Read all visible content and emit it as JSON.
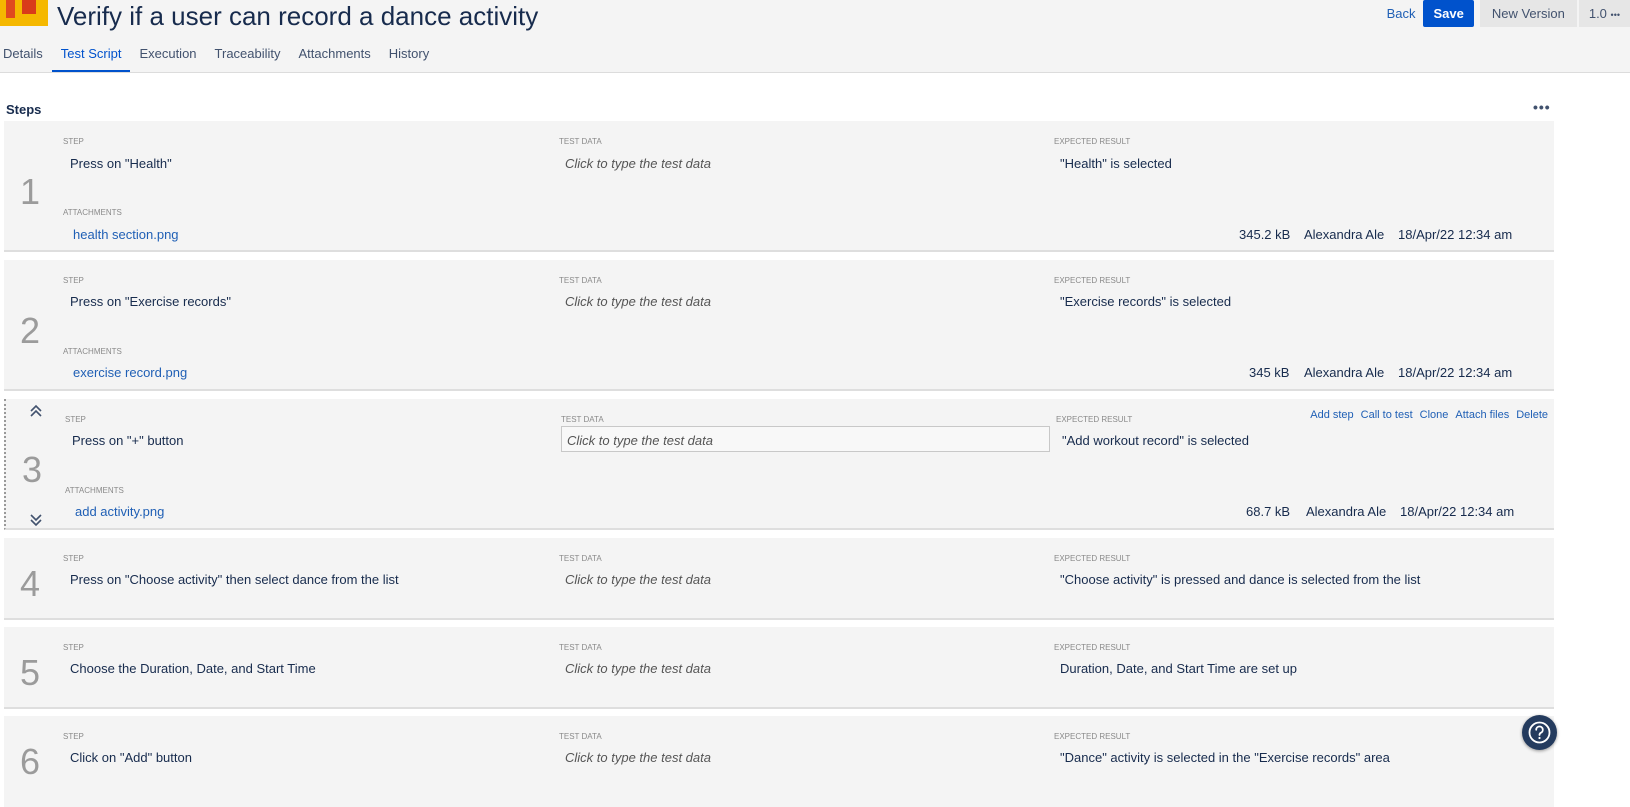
{
  "header": {
    "title": "Verify if a user can record a dance activity",
    "back_label": "Back",
    "save_label": "Save",
    "new_version_label": "New Version",
    "version_label": "1.0",
    "version_more": "•••"
  },
  "tabs": [
    {
      "label": "Details",
      "active": false
    },
    {
      "label": "Test Script",
      "active": true
    },
    {
      "label": "Execution",
      "active": false
    },
    {
      "label": "Traceability",
      "active": false
    },
    {
      "label": "Attachments",
      "active": false
    },
    {
      "label": "History",
      "active": false
    }
  ],
  "steps_section": {
    "title": "Steps",
    "more": "•••",
    "labels": {
      "step": "STEP",
      "test_data": "TEST DATA",
      "expected_result": "EXPECTED RESULT",
      "attachments": "ATTACHMENTS"
    },
    "test_data_placeholder": "Click to type the test data",
    "actions": [
      "Add step",
      "Call to test",
      "Clone",
      "Attach files",
      "Delete"
    ]
  },
  "steps": [
    {
      "number": "1",
      "step": "Press on \"Health\"",
      "expected": "\"Health\" is selected",
      "attachment": {
        "name": "health section.png",
        "size": "345.2 kB",
        "author": "Alexandra Ale",
        "date": "18/Apr/22 12:34 am"
      }
    },
    {
      "number": "2",
      "step": "Press on \"Exercise records\"",
      "expected": "\"Exercise records\" is selected",
      "attachment": {
        "name": "exercise record.png",
        "size": "345 kB",
        "author": "Alexandra Ale",
        "date": "18/Apr/22 12:34 am"
      }
    },
    {
      "number": "3",
      "step": "Press on \"+\" button",
      "expected": "\"Add workout record\" is selected",
      "attachment": {
        "name": "add activity.png",
        "size": "68.7 kB",
        "author": "Alexandra Ale",
        "date": "18/Apr/22 12:34 am"
      }
    },
    {
      "number": "4",
      "step": "Press on \"Choose activity\" then select dance from the list",
      "expected": "\"Choose activity\" is pressed and dance is selected from the list"
    },
    {
      "number": "5",
      "step": "Choose the Duration, Date, and Start Time",
      "expected": "Duration, Date, and Start Time are set up"
    },
    {
      "number": "6",
      "step": "Click on \"Add\" button",
      "expected": "\"Dance\" activity is selected in the \"Exercise records\" area"
    }
  ],
  "icons": {
    "app": "test-case-icon",
    "help": "help-icon",
    "move_up": "chevron-double-up-icon",
    "move_down": "chevron-double-down-icon"
  },
  "colors": {
    "brand_blue": "#0052cc",
    "link_blue": "#1f5fb5",
    "step_bg": "#f4f4f4",
    "help_bg": "#243b5e"
  }
}
